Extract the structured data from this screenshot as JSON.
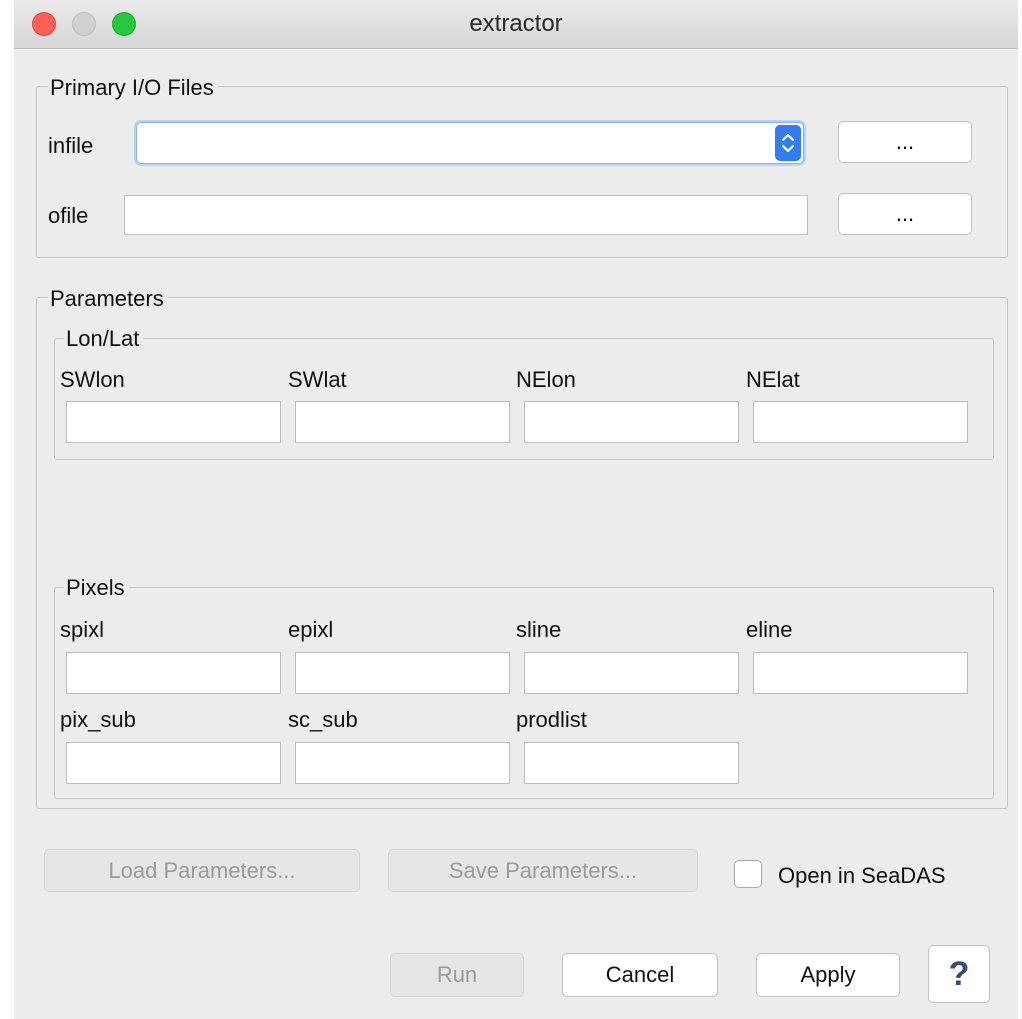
{
  "window": {
    "title": "extractor"
  },
  "io": {
    "group_label": "Primary I/O Files",
    "infile_label": "infile",
    "ofile_label": "ofile",
    "infile_value": "",
    "ofile_value": "",
    "browse_label": "..."
  },
  "params": {
    "group_label": "Parameters",
    "lonlat": {
      "group_label": "Lon/Lat",
      "fields": [
        "SWlon",
        "SWlat",
        "NElon",
        "NElat"
      ]
    },
    "pixels": {
      "group_label": "Pixels",
      "row1": [
        "spixl",
        "epixl",
        "sline",
        "eline"
      ],
      "row2": [
        "pix_sub",
        "sc_sub",
        "prodlist"
      ]
    }
  },
  "actions": {
    "load": "Load Parameters...",
    "save": "Save Parameters...",
    "open_in_seadas": "Open in SeaDAS",
    "open_in_seadas_checked": false,
    "run": "Run",
    "cancel": "Cancel",
    "apply": "Apply",
    "help": "?"
  },
  "colors": {
    "close": "#fe5f57",
    "minimize": "#d0d0d0",
    "maximize": "#28c840",
    "focus": "#2f7ef5"
  }
}
